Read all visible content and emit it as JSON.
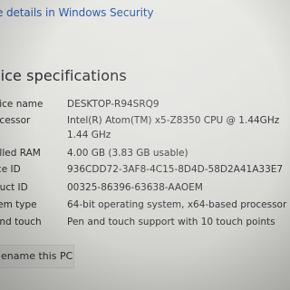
{
  "link": {
    "text": "e details in Windows Security"
  },
  "section": {
    "title": "vice specifications"
  },
  "specs": [
    {
      "label": "vice name",
      "value": "DESKTOP-R94SRQ9"
    },
    {
      "label": "ocessor",
      "value": "Intel(R) Atom(TM) x5-Z8350  CPU @ 1.44GHz",
      "value2": "1.44 GHz"
    },
    {
      "label": "alled RAM",
      "value": "4.00 GB (3.83 GB usable)"
    },
    {
      "label": "ice ID",
      "value": "936CDD72-3AF8-4C15-8D4D-58D2A41A33E7"
    },
    {
      "label": "duct ID",
      "value": "00325-86396-63638-AAOEM"
    },
    {
      "label": "tem type",
      "value": "64-bit operating system, x64-based processor"
    },
    {
      "label": "and touch",
      "value": "Pen and touch support with 10 touch points"
    }
  ],
  "rename_button": {
    "label": "ename this PC"
  }
}
